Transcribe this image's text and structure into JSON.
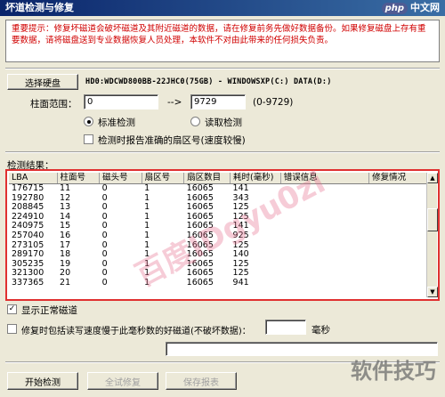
{
  "window": {
    "title": "坏道检测与修复"
  },
  "site_logo": {
    "badge": "php",
    "text": "中文网"
  },
  "warning_text": "重要提示：修复坏磁道会破坏磁道及其附近磁道的数据，请在修复前务先做好数据备份。如果修复磁盘上存有重要数据，请将磁盘送到专业数据恢复人员处理，本软件不对由此带来的任何损失负责。",
  "hdd": {
    "select_button": "选择硬盘",
    "info": "HD0:WDCWD800BB-22JHC0(75GB) - WINDOWSXP(C:) DATA(D:)"
  },
  "cylinder": {
    "label": "柱面范围：",
    "start": "0",
    "arrow": "-->",
    "end": "9729",
    "range_hint": "(0-9729)"
  },
  "modes": {
    "standard": "标准检测",
    "read": "读取检测",
    "report_option": "检测时报告准确的扇区号(速度较慢)"
  },
  "results": {
    "label": "检测结果：",
    "columns": [
      "LBA",
      "柱面号",
      "磁头号",
      "扇区号",
      "扇区数目",
      "耗时(毫秒)",
      "错误信息",
      "修复情况"
    ],
    "rows": [
      [
        "176715",
        "11",
        "0",
        "1",
        "16065",
        "141",
        "",
        ""
      ],
      [
        "192780",
        "12",
        "0",
        "1",
        "16065",
        "343",
        "",
        ""
      ],
      [
        "208845",
        "13",
        "0",
        "1",
        "16065",
        "125",
        "",
        ""
      ],
      [
        "224910",
        "14",
        "0",
        "1",
        "16065",
        "125",
        "",
        ""
      ],
      [
        "240975",
        "15",
        "0",
        "1",
        "16065",
        "141",
        "",
        ""
      ],
      [
        "257040",
        "16",
        "0",
        "1",
        "16065",
        "925",
        "",
        ""
      ],
      [
        "273105",
        "17",
        "0",
        "1",
        "16065",
        "125",
        "",
        ""
      ],
      [
        "289170",
        "18",
        "0",
        "1",
        "16065",
        "140",
        "",
        ""
      ],
      [
        "305235",
        "19",
        "0",
        "1",
        "16065",
        "125",
        "",
        ""
      ],
      [
        "321300",
        "20",
        "0",
        "1",
        "16065",
        "125",
        "",
        ""
      ],
      [
        "337365",
        "21",
        "0",
        "1",
        "16065",
        "941",
        "",
        ""
      ]
    ]
  },
  "options": {
    "show_normal": "显示正常磁道",
    "repair_slow_prefix": "修复时包括读写速度慢于此毫秒数的好磁道(不破坏数据)：",
    "ms_unit": "毫秒"
  },
  "buttons": {
    "start": "开始检测",
    "repair": "全试修复",
    "save_report": "保存报表"
  },
  "watermark": "百度IDgyu0zi",
  "corner_watermark": "软件技巧"
}
